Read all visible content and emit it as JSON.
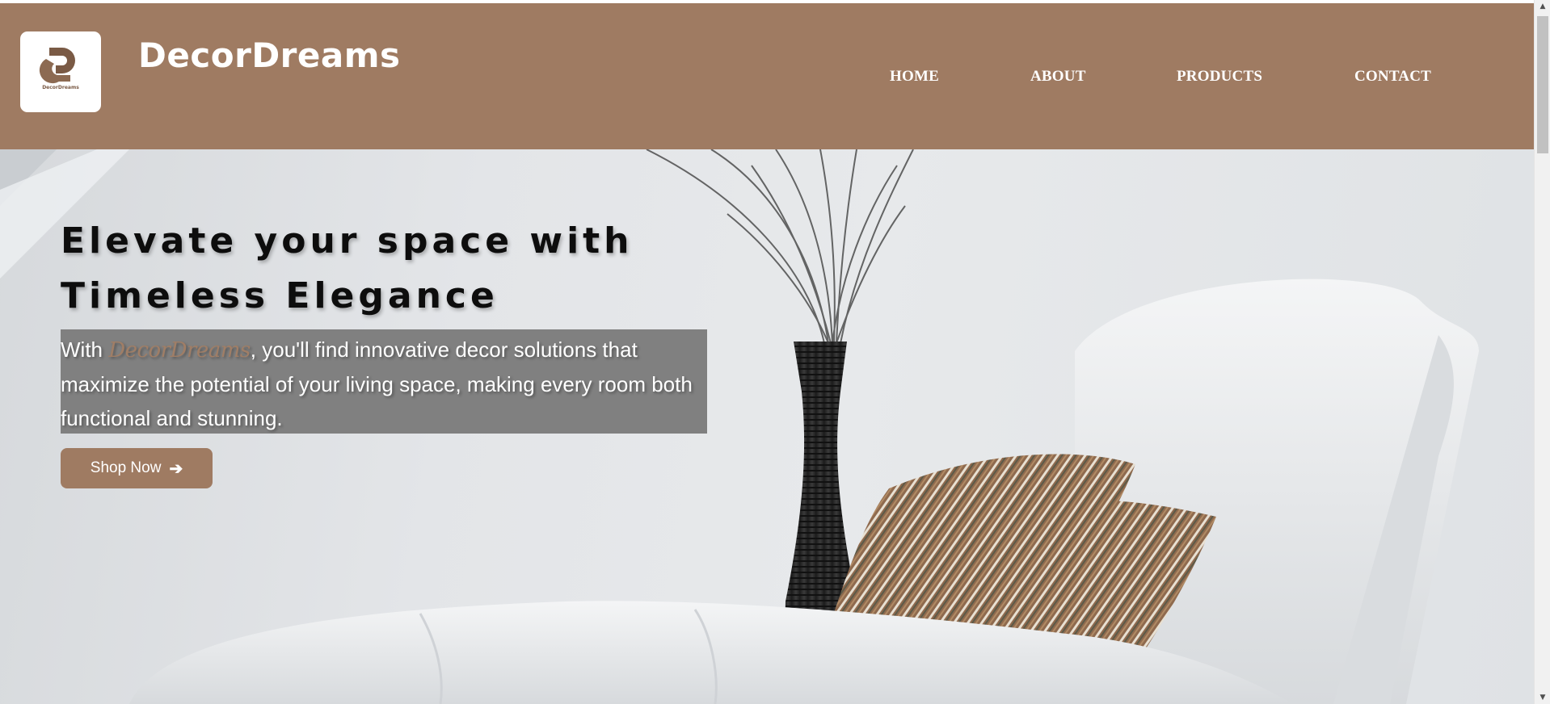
{
  "header": {
    "brand": "DecorDreams",
    "logo_caption": "DecorDreams",
    "nav": [
      {
        "label": "HOME"
      },
      {
        "label": "ABOUT"
      },
      {
        "label": "PRODUCTS"
      },
      {
        "label": "CONTACT"
      }
    ]
  },
  "hero": {
    "headline_line1": "Elevate your space with",
    "headline_line2": "Timeless Elegance",
    "desc_prefix": "With ",
    "desc_brand": "DecorDreams",
    "desc_suffix": ", you'll find innovative decor solutions that maximize the potential of your living space, making every room both functional and stunning.",
    "cta_label": "Shop Now",
    "cta_icon": "arrow-right-icon"
  },
  "colors": {
    "brand": "#9f7b62",
    "desc_bg": "#808080",
    "header_text": "#ffffff"
  }
}
